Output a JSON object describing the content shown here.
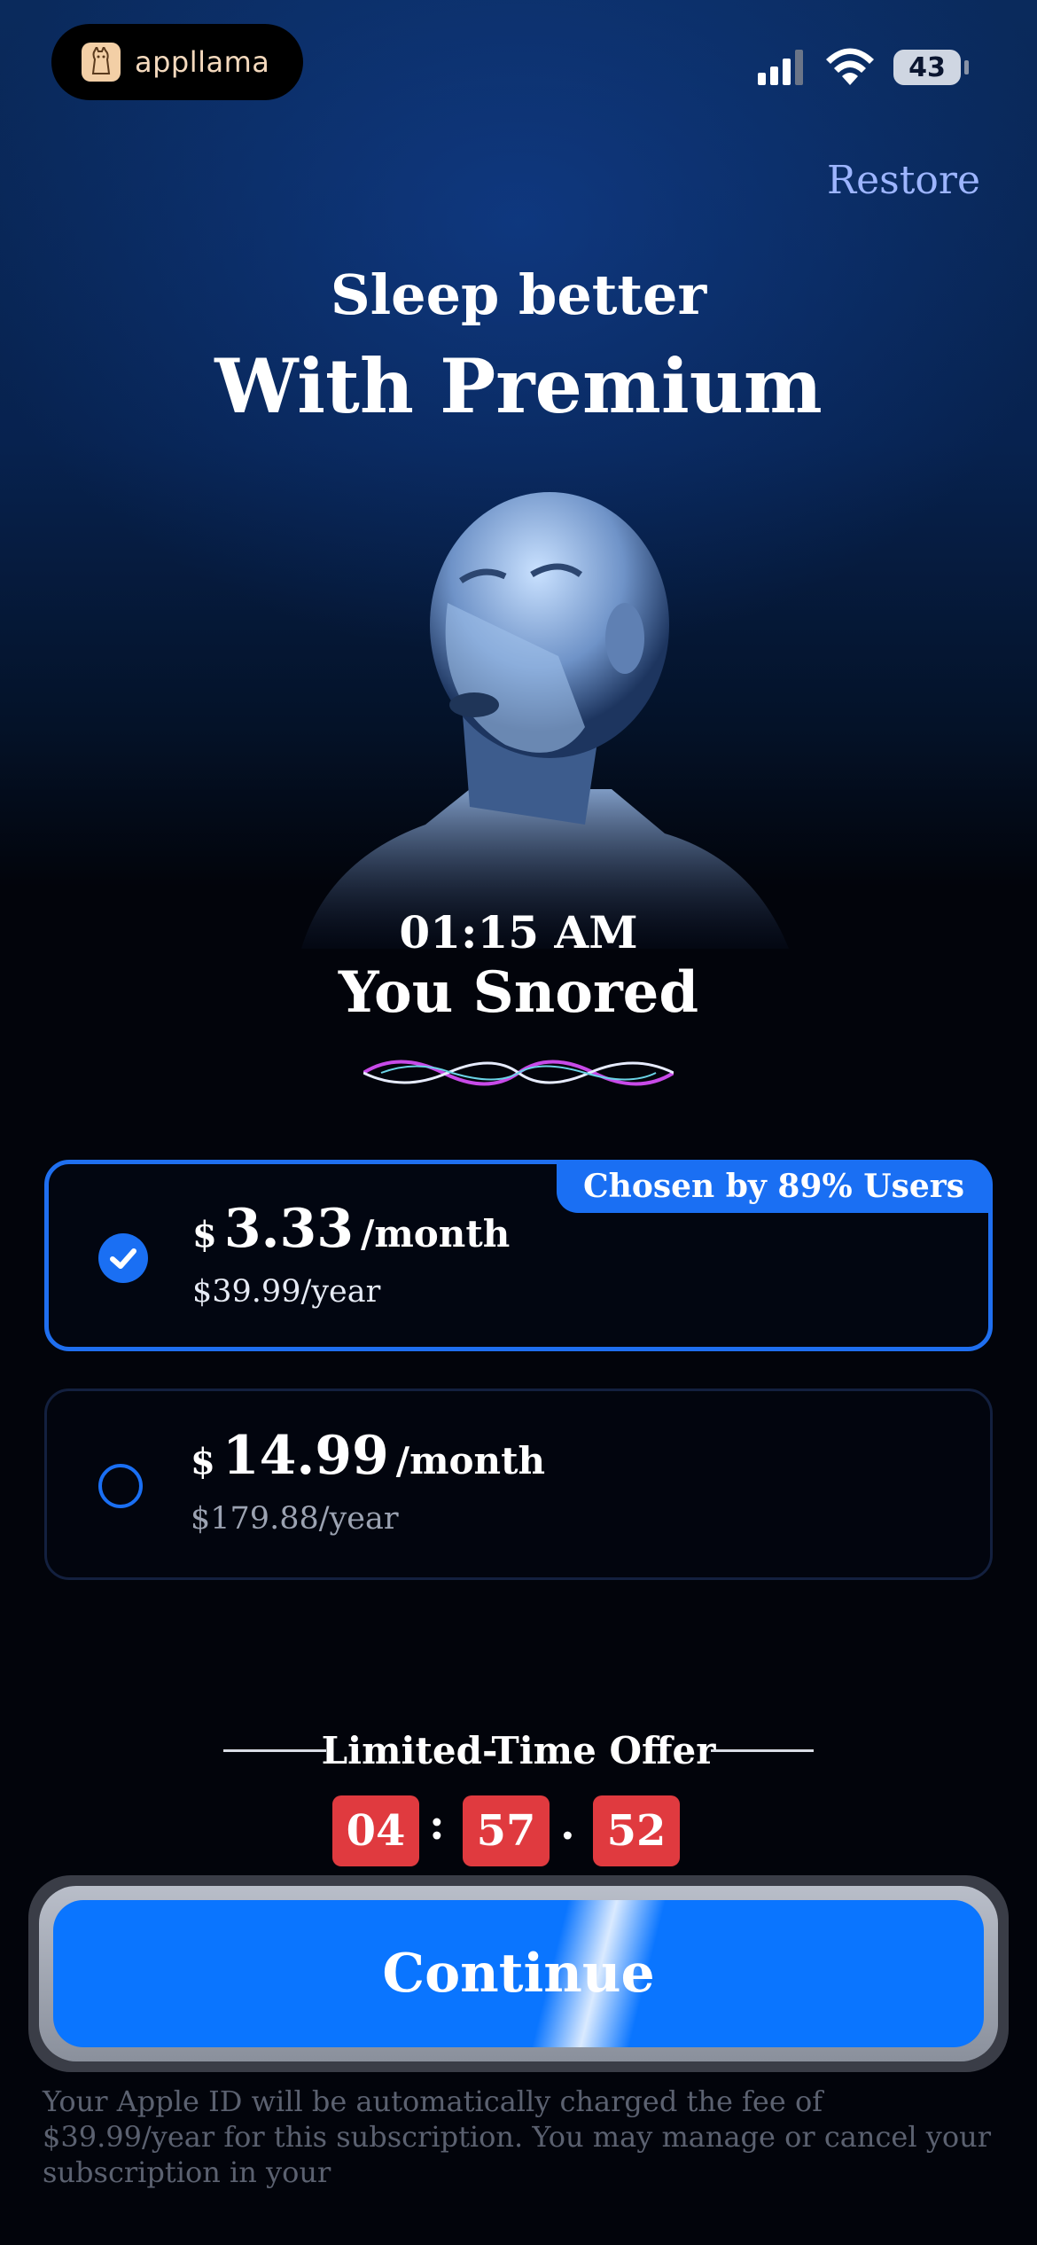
{
  "status_bar": {
    "brand": "appllama",
    "battery": "43",
    "icons": [
      "cellular-signal-icon",
      "wifi-icon",
      "battery-icon"
    ]
  },
  "header": {
    "restore_label": "Restore",
    "title_line1": "Sleep better",
    "title_line2": "With Premium"
  },
  "hero": {
    "image": "sleeping-face-illustration",
    "time": "01:15 AM",
    "event": "You Snored"
  },
  "plans": [
    {
      "currency": "$",
      "amount": "3.33",
      "period": "/month",
      "annual": "$39.99/year",
      "badge": "Chosen by 89% Users",
      "selected": true
    },
    {
      "currency": "$",
      "amount": "14.99",
      "period": "/month",
      "annual": "$179.88/year",
      "selected": false
    }
  ],
  "offer": {
    "label": "Limited-Time Offer",
    "timer": {
      "hours": "04",
      "sep1": ":",
      "minutes": "57",
      "sep2": ".",
      "seconds": "52"
    }
  },
  "cta": {
    "label": "Continue"
  },
  "legal": "Your Apple ID will be automatically charged the fee of $39.99/year for this subscription. You may manage or cancel your subscription in your",
  "colors": {
    "accent": "#1a6ff3",
    "cta": "#0a75ff",
    "timer": "#e03a3f",
    "restore": "#9db5ff"
  }
}
